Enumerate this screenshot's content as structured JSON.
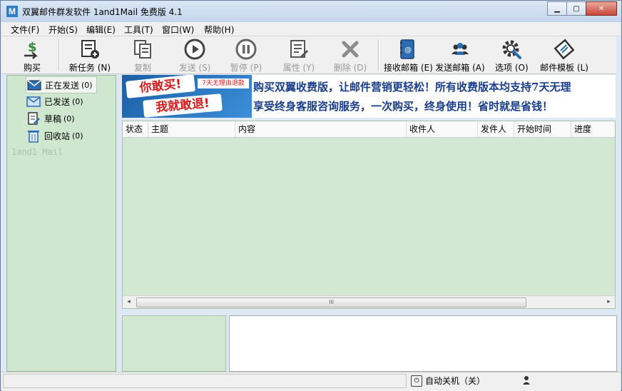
{
  "window": {
    "title": "双翼邮件群发软件 1and1Mail 免费版 4.1",
    "app_icon": "M"
  },
  "menu": [
    "文件(F)",
    "开始(S)",
    "编辑(E)",
    "工具(T)",
    "窗口(W)",
    "帮助(H)"
  ],
  "toolbar": {
    "buy": "购买",
    "new_task": "新任务 (N)",
    "copy": "复制",
    "send": "发送 (S)",
    "pause": "暂停 (P)",
    "properties": "属性 (Y)",
    "delete": "删除 (D)",
    "inbox": "接收邮箱 (E)",
    "sender": "发送邮箱 (A)",
    "options": "选项 (O)",
    "template": "邮件模板 (L)"
  },
  "sidebar": {
    "items": [
      {
        "label": "正在发送",
        "count": "(0)"
      },
      {
        "label": "已发送",
        "count": "(0)"
      },
      {
        "label": "草稿",
        "count": "(0)"
      },
      {
        "label": "回收站",
        "count": "(0)"
      }
    ],
    "brand": "1and1 Mail"
  },
  "banner": {
    "image_line1": "你敢买!",
    "image_line2": "我就敢退!",
    "image_tag": "7天无理由退款",
    "line1": "购买双翼收费版，让邮件营销更轻松！所有收费版本均支持7天无理",
    "line2": "享受终身客服咨询服务，一次购买，终身使用！省时就是省钱！"
  },
  "table": {
    "columns": [
      "状态",
      "主题",
      "内容",
      "收件人",
      "发件人",
      "开始时间",
      "进度"
    ],
    "scroll_left": "◂",
    "scroll_right": "▸",
    "thumb_grip": "III"
  },
  "statusbar": {
    "auto_shutdown": "自动关机（关）"
  }
}
